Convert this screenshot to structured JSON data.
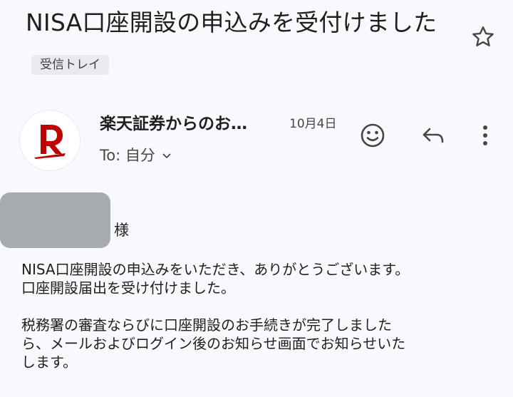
{
  "email": {
    "subject": "NISA口座開設の申込みを受付けました",
    "label": "受信トレイ",
    "sender": "楽天証券からのお…",
    "date": "10月4日",
    "recipient": "To: 自分",
    "greeting_suffix": "様",
    "body": [
      "NISA口座開設の申込みをいただき、ありがとうございます。",
      "口座開設届出を受け付けました。",
      "",
      "税務署の審査ならびに口座開設のお手続きが完了しました",
      "ら、メールおよびログイン後のお知らせ画面でお知らせいた",
      "します。"
    ]
  },
  "icons": {
    "star": "star-outline-icon",
    "emoji": "smiley-icon",
    "reply": "reply-icon",
    "more": "more-vert-icon",
    "chevron": "chevron-down-icon",
    "avatar_logo": "rakuten-r-logo"
  },
  "colors": {
    "background": "#f7f9fd",
    "brand_red": "#bf0000",
    "redaction": "#a7aaaf"
  }
}
